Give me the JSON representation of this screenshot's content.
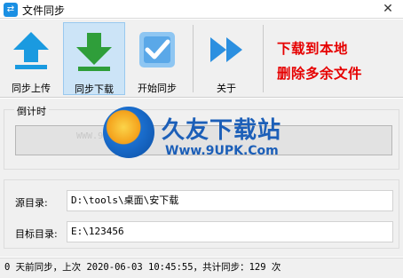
{
  "window": {
    "title": "文件同步",
    "close_glyph": "✕"
  },
  "toolbar": {
    "buttons": [
      {
        "label": "同步上传",
        "icon": "upload-arrow-icon",
        "color": "#1a9ae0"
      },
      {
        "label": "同步下载",
        "icon": "download-arrow-icon",
        "color": "#2f9e3a",
        "active": true
      },
      {
        "label": "开始同步",
        "icon": "checkbox-check-icon",
        "color": "#5aa8e8"
      },
      {
        "label": "关于",
        "icon": "fast-forward-icon",
        "color": "#2b8fe0"
      }
    ]
  },
  "promo": {
    "line1": "下载到本地",
    "line2": "删除多余文件",
    "color": "#e60000"
  },
  "countdown": {
    "title": "倒计时",
    "progress": 0
  },
  "paths": {
    "source_label": "源目录:",
    "source_value": "D:\\tools\\桌面\\安下载",
    "target_label": "目标目录:",
    "target_value": "E:\\123456"
  },
  "status": {
    "text": "0 天前同步，上次 2020-06-03 10:45:55，共计同步：129 次"
  },
  "watermark": {
    "brand": "久友下载站",
    "url": "Www.9UPK.Com",
    "url_left": "WWW.9UPK.COM"
  }
}
